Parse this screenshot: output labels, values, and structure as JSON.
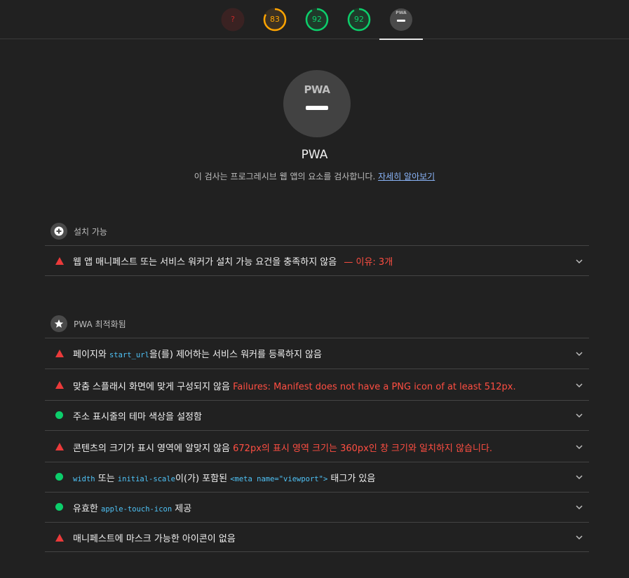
{
  "top_gauges": [
    {
      "label": "?",
      "color": "#c62828",
      "track": "#3a2222",
      "progress": 0
    },
    {
      "label": "83",
      "color": "#ffa400",
      "track": "#3b3022",
      "progress": 0.83
    },
    {
      "label": "92",
      "color": "#0cce6b",
      "track": "#1f3a2a",
      "progress": 0.92
    },
    {
      "label": "92",
      "color": "#0cce6b",
      "track": "#1f3a2a",
      "progress": 0.92
    }
  ],
  "pwa_tab": {
    "badge_text": "PWA"
  },
  "hero": {
    "badge_text": "PWA",
    "title": "PWA",
    "description": "이 검사는 프로그레시브 웹 앱의 요소를 검사합니다.",
    "learn_more": "자세히 알아보기"
  },
  "groups": {
    "installable": {
      "label": "설치 가능",
      "icon": "plus-icon",
      "audits": [
        {
          "status": "fail",
          "title": "웹 앱 매니페스트 또는 서비스 워커가 설치 가능 요건을 충족하지 않음",
          "extra": "— 이유: 3개"
        }
      ]
    },
    "optimized": {
      "label": "PWA 최적화됨",
      "icon": "star-icon",
      "audits": [
        {
          "status": "fail",
          "pre": "페이지와 ",
          "code": "start_url",
          "post": "을(를) 제어하는 서비스 워커를 등록하지 않음"
        },
        {
          "status": "fail",
          "title": "맞춤 스플래시 화면에 맞게 구성되지 않음",
          "extra": "Failures: Manifest does not have a PNG icon of at least 512px."
        },
        {
          "status": "pass",
          "title": "주소 표시줄의 테마 색상을 설정함"
        },
        {
          "status": "fail",
          "title": "콘텐츠의 크기가 표시 영역에 알맞지 않음",
          "extra": "672px의 표시 영역 크기는 360px인 창 크기와 일치하지 않습니다."
        },
        {
          "status": "pass",
          "code1": "width",
          "mid1": " 또는 ",
          "code2": "initial-scale",
          "mid2": "이(가) 포함된 ",
          "code3": "<meta name=\"viewport\">",
          "post": " 태그가 있음"
        },
        {
          "status": "pass",
          "pre": "유효한 ",
          "code": "apple-touch-icon",
          "post": " 제공"
        },
        {
          "status": "fail",
          "title": "매니페스트에 마스크 가능한 아이콘이 없음"
        }
      ]
    }
  }
}
